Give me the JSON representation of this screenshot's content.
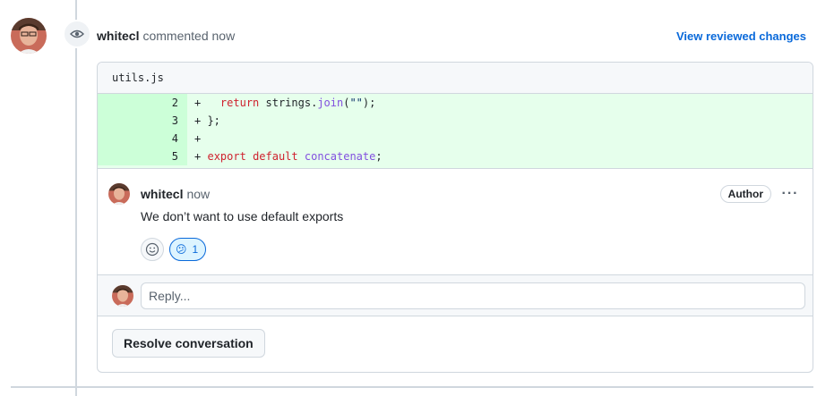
{
  "event": {
    "author": "whitecl",
    "action": "commented now",
    "view_link": "View reviewed changes"
  },
  "file": {
    "name": "utils.js"
  },
  "diff": {
    "lines": [
      {
        "num": "2",
        "marker": "+",
        "tokens": [
          {
            "t": "   ",
            "c": ""
          },
          {
            "t": "return",
            "c": "kw"
          },
          {
            "t": " strings.",
            "c": ""
          },
          {
            "t": "join",
            "c": "fn"
          },
          {
            "t": "(",
            "c": ""
          },
          {
            "t": "\"\"",
            "c": "str"
          },
          {
            "t": ");",
            "c": ""
          }
        ]
      },
      {
        "num": "3",
        "marker": "+",
        "tokens": [
          {
            "t": " };",
            "c": ""
          }
        ]
      },
      {
        "num": "4",
        "marker": "+",
        "tokens": [
          {
            "t": "",
            "c": ""
          }
        ]
      },
      {
        "num": "5",
        "marker": "+",
        "tokens": [
          {
            "t": " ",
            "c": ""
          },
          {
            "t": "export",
            "c": "kw"
          },
          {
            "t": " ",
            "c": ""
          },
          {
            "t": "default",
            "c": "kw"
          },
          {
            "t": " ",
            "c": ""
          },
          {
            "t": "concatenate",
            "c": "fn"
          },
          {
            "t": ";",
            "c": ""
          }
        ]
      }
    ]
  },
  "comment": {
    "author": "whitecl",
    "time": "now",
    "badge": "Author",
    "more": "···",
    "body": "We don’t want to use default exports",
    "reaction": {
      "emoji": "😕",
      "count": "1"
    }
  },
  "reply": {
    "placeholder": "Reply..."
  },
  "resolve_label": "Resolve conversation",
  "icons": {
    "eye": "eye-icon",
    "smiley": "smiley-icon",
    "kebab": "kebab-horizontal-icon"
  },
  "colors": {
    "link": "#0969da",
    "diff_add_bg": "#e6ffec",
    "diff_add_num_bg": "#ccffd8",
    "border": "#d0d7de"
  }
}
